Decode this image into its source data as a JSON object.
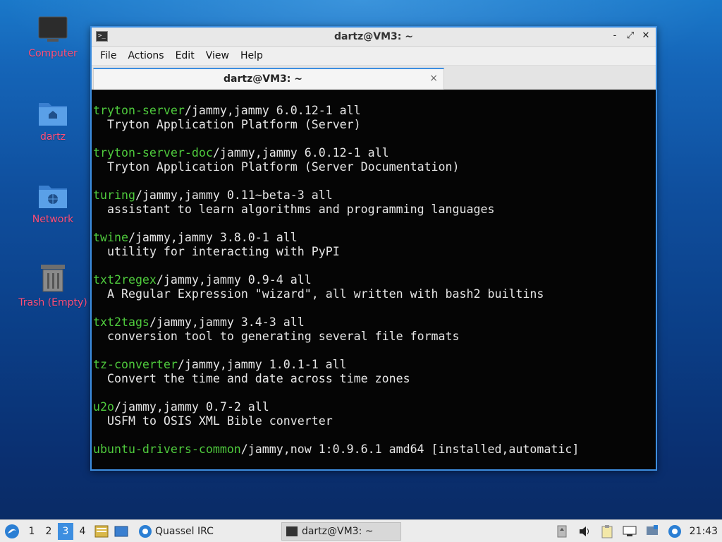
{
  "desktop": {
    "icons": [
      {
        "label": "Computer",
        "icon": "computer-icon"
      },
      {
        "label": "dartz",
        "icon": "home-folder-icon"
      },
      {
        "label": "Network",
        "icon": "network-folder-icon"
      },
      {
        "label": "Trash (Empty)",
        "icon": "trash-icon"
      }
    ]
  },
  "window": {
    "title": "dartz@VM3: ~",
    "controls": {
      "minimize": "-",
      "maximize": "⤢",
      "close": "✕"
    },
    "menu": [
      "File",
      "Actions",
      "Edit",
      "View",
      "Help"
    ],
    "tab": {
      "label": "dartz@VM3: ~",
      "close": "×"
    },
    "colors": {
      "border": "#3d8ee0",
      "package_name": "#4fcb3d",
      "text": "#e6e6e6",
      "background": "#050505"
    }
  },
  "terminal": {
    "entries": [
      {
        "name": "tryton-server",
        "rest": "/jammy,jammy 6.0.12-1 all",
        "desc": "Tryton Application Platform (Server)"
      },
      {
        "name": "tryton-server-doc",
        "rest": "/jammy,jammy 6.0.12-1 all",
        "desc": "Tryton Application Platform (Server Documentation)"
      },
      {
        "name": "turing",
        "rest": "/jammy,jammy 0.11~beta-3 all",
        "desc": "assistant to learn algorithms and programming languages"
      },
      {
        "name": "twine",
        "rest": "/jammy,jammy 3.8.0-1 all",
        "desc": "utility for interacting with PyPI"
      },
      {
        "name": "txt2regex",
        "rest": "/jammy,jammy 0.9-4 all",
        "desc": "A Regular Expression \"wizard\", all written with bash2 builtins"
      },
      {
        "name": "txt2tags",
        "rest": "/jammy,jammy 3.4-3 all",
        "desc": "conversion tool to generating several file formats"
      },
      {
        "name": "tz-converter",
        "rest": "/jammy,jammy 1.0.1-1 all",
        "desc": "Convert the time and date across time zones"
      },
      {
        "name": "u2o",
        "rest": "/jammy,jammy 0.7-2 all",
        "desc": "USFM to OSIS XML Bible converter"
      },
      {
        "name": "ubuntu-drivers-common",
        "rest": "/jammy,now 1:0.9.6.1 amd64 [installed,automatic]",
        "desc": ""
      }
    ]
  },
  "taskbar": {
    "start_icon": "lubuntu-logo-icon",
    "workspaces": [
      "1",
      "2",
      "3",
      "4"
    ],
    "active_workspace": "3",
    "quassel_label": "Quassel IRC",
    "terminal_task_label": "dartz@VM3: ~",
    "clock": "21:43"
  }
}
